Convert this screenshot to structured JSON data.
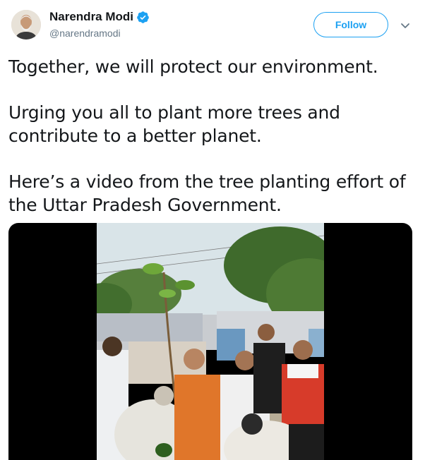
{
  "user": {
    "display_name": "Narendra Modi",
    "handle": "@narendramodi",
    "verified": true,
    "verified_icon": "verified-badge-icon"
  },
  "actions": {
    "follow_label": "Follow",
    "more_icon": "chevron-down-icon"
  },
  "tweet": {
    "paragraphs": [
      "Together, we will protect our environment.",
      "Urging you all to plant more trees and contribute to a better planet.",
      "Here’s a video from the tree planting effort of the Uttar Pradesh Government."
    ]
  },
  "colors": {
    "brand": "#1da1f2",
    "text": "#14171a",
    "secondary": "#657786"
  }
}
